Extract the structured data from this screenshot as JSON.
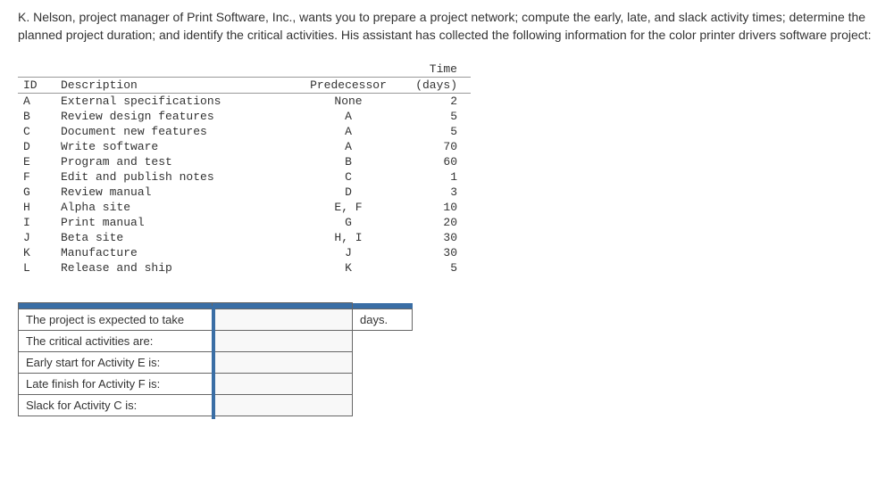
{
  "intro": "K. Nelson, project manager of Print Software, Inc., wants you to prepare a project network; compute the early, late, and slack activity times; determine the planned project duration; and identify the critical activities. His assistant has collected the following information for the color printer drivers software project:",
  "table": {
    "headers": {
      "id": "ID",
      "description": "Description",
      "predecessor": "Predecessor",
      "time_top": "Time",
      "time_bottom": "(days)"
    },
    "rows": [
      {
        "id": "A",
        "desc": "External specifications",
        "pred": "None",
        "time": "2"
      },
      {
        "id": "B",
        "desc": "Review design features",
        "pred": "A",
        "time": "5"
      },
      {
        "id": "C",
        "desc": "Document new features",
        "pred": "A",
        "time": "5"
      },
      {
        "id": "D",
        "desc": "Write software",
        "pred": "A",
        "time": "70"
      },
      {
        "id": "E",
        "desc": "Program and test",
        "pred": "B",
        "time": "60"
      },
      {
        "id": "F",
        "desc": "Edit and publish notes",
        "pred": "C",
        "time": "1"
      },
      {
        "id": "G",
        "desc": "Review manual",
        "pred": "D",
        "time": "3"
      },
      {
        "id": "H",
        "desc": "Alpha site",
        "pred": "E, F",
        "time": "10"
      },
      {
        "id": "I",
        "desc": "Print manual",
        "pred": "G",
        "time": "20"
      },
      {
        "id": "J",
        "desc": "Beta site",
        "pred": "H, I",
        "time": "30"
      },
      {
        "id": "K",
        "desc": "Manufacture",
        "pred": "J",
        "time": "30"
      },
      {
        "id": "L",
        "desc": "Release and ship",
        "pred": "K",
        "time": "5"
      }
    ]
  },
  "answers": {
    "rows": [
      {
        "label": "The project is expected to take",
        "unit": "days."
      },
      {
        "label": "The critical activities are:",
        "unit": ""
      },
      {
        "label": "Early start for Activity E is:",
        "unit": ""
      },
      {
        "label": "Late finish for Activity F is:",
        "unit": ""
      },
      {
        "label": "Slack for Activity C is:",
        "unit": ""
      }
    ]
  }
}
